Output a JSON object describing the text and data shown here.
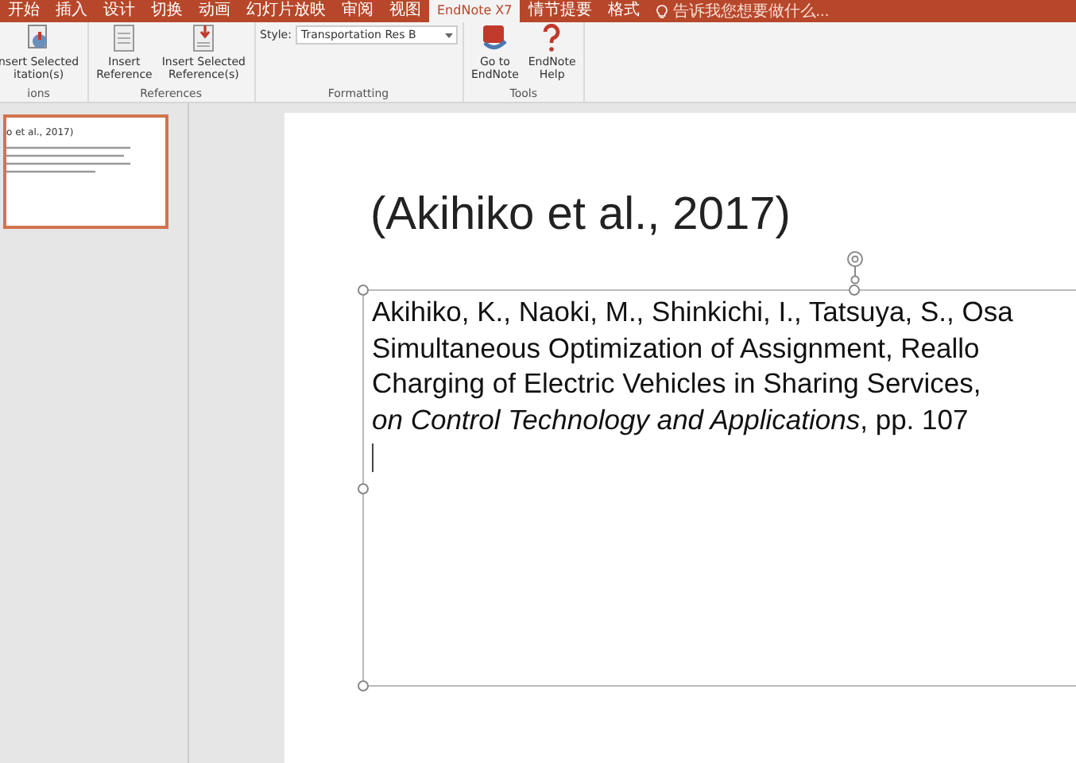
{
  "tabs": [
    {
      "label": "开始",
      "selected": false
    },
    {
      "label": "插入",
      "selected": false
    },
    {
      "label": "设计",
      "selected": false
    },
    {
      "label": "切换",
      "selected": false
    },
    {
      "label": "动画",
      "selected": false
    },
    {
      "label": "幻灯片放映",
      "selected": false
    },
    {
      "label": "审阅",
      "selected": false
    },
    {
      "label": "视图",
      "selected": false
    },
    {
      "label": "EndNote X7",
      "selected": true
    },
    {
      "label": "情节提要",
      "selected": false
    },
    {
      "label": "格式",
      "selected": false
    }
  ],
  "search": {
    "placeholder": "告诉我您想要做什么..."
  },
  "ribbon_groups": [
    {
      "kind": "buttons",
      "label": "ions",
      "buttons": [
        {
          "kind": "citation",
          "lines": [
            "nsert Selected",
            "itation(s)"
          ]
        }
      ]
    },
    {
      "kind": "buttons",
      "label": "References",
      "buttons": [
        {
          "kind": "reference",
          "lines": [
            "Insert",
            "Reference"
          ]
        },
        {
          "kind": "selected",
          "lines": [
            "Insert Selected",
            "Reference(s)"
          ]
        }
      ]
    },
    {
      "kind": "style",
      "label": "Formatting",
      "style_label": "Style:",
      "style_value": "Transportation Res B"
    },
    {
      "kind": "buttons",
      "label": "Tools",
      "buttons": [
        {
          "kind": "goto",
          "lines": [
            "Go to",
            "EndNote"
          ]
        },
        {
          "kind": "help",
          "lines": [
            "EndNote",
            "Help"
          ]
        }
      ]
    }
  ],
  "thumbnails": [
    {
      "title": "o et al., 2017)",
      "selected": true
    }
  ],
  "slide": {
    "title": "(Akihiko et al., 2017)",
    "body_lines": [
      "Akihiko, K., Naoki, M., Shinkichi, I., Tatsuya, S., Osa",
      "Simultaneous Optimization of Assignment, Reallo",
      "Charging of Electric Vehicles in Sharing Services,",
      "*on Control Technology and Applications*, pp. 107"
    ]
  }
}
